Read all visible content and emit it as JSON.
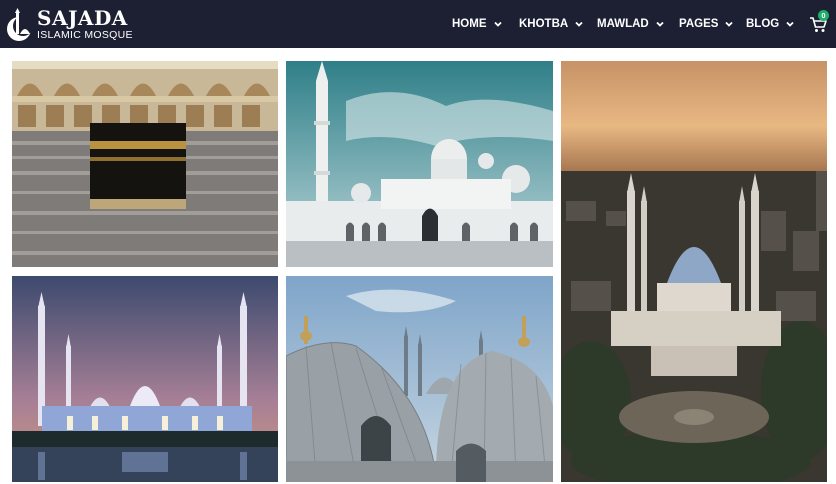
{
  "brand": {
    "name": "SAJADA",
    "tagline": "ISLAMIC MOSQUE"
  },
  "nav": {
    "items": [
      {
        "label": "HOME"
      },
      {
        "label": "KHOTBA"
      },
      {
        "label": "MAWLAD"
      },
      {
        "label": "PAGES"
      },
      {
        "label": "BLOG"
      }
    ]
  },
  "cart": {
    "count": "0",
    "icon": "cart-icon"
  },
  "colors": {
    "navbar": "#1d2033",
    "accent": "#1fae6b",
    "text": "#ffffff"
  },
  "gallery": {
    "images": [
      {
        "subject": "kaaba-crowd"
      },
      {
        "subject": "white-mosque-sky"
      },
      {
        "subject": "mosque-city-sunset"
      },
      {
        "subject": "mosque-night-reflection"
      },
      {
        "subject": "mosque-domes"
      }
    ]
  }
}
